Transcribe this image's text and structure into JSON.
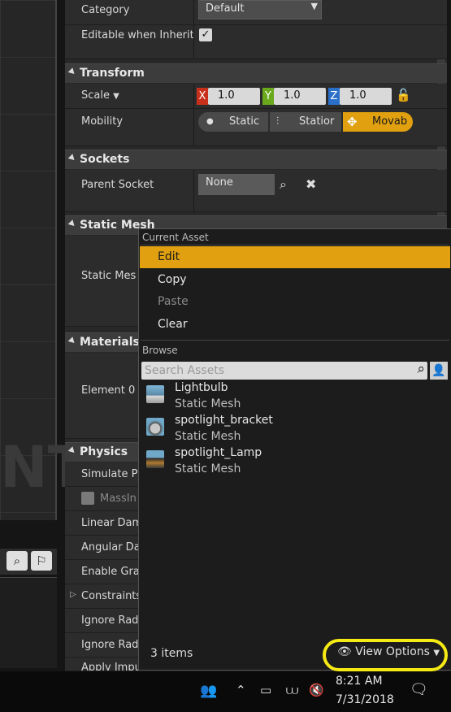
{
  "viewport": {
    "overlay_text": "NT"
  },
  "details": {
    "category_label": "Category",
    "category_value": "Default",
    "editable_label": "Editable when Inherit",
    "transform": {
      "title": "Transform",
      "scale_label": "Scale",
      "x_axis": "X",
      "x_value": "1.0",
      "y_axis": "Y",
      "y_value": "1.0",
      "z_axis": "Z",
      "z_value": "1.0",
      "mobility_label": "Mobility",
      "mobility_options": [
        "Static",
        "Statior",
        "Movab"
      ],
      "mobility_selected": "Movab"
    },
    "sockets": {
      "title": "Sockets",
      "parent_socket_label": "Parent Socket",
      "parent_socket_value": "None"
    },
    "static_mesh": {
      "title": "Static Mesh",
      "static_mesh_label": "Static Mes"
    },
    "materials": {
      "title": "Materials",
      "element0_label": "Element 0"
    },
    "physics": {
      "title": "Physics",
      "rows": [
        "Simulate P",
        "MassIn",
        "Linear Dam",
        "Angular Da",
        "Enable Gra",
        "Constraints",
        "Ignore Rad",
        "Ignore Rad",
        "Apply Impu"
      ]
    }
  },
  "menu": {
    "current_asset_header": "Current Asset",
    "items": [
      "Edit",
      "Copy",
      "Paste",
      "Clear"
    ],
    "browse_header": "Browse",
    "search_placeholder": "Search Assets",
    "assets": [
      {
        "name": "Lightbulb",
        "type": "Static Mesh"
      },
      {
        "name": "spotlight_bracket",
        "type": "Static Mesh"
      },
      {
        "name": "spotlight_Lamp",
        "type": "Static Mesh"
      }
    ],
    "item_count": "3 items",
    "view_options": "View Options"
  },
  "taskbar": {
    "time": "8:21 AM",
    "date": "7/31/2018"
  },
  "colors": {
    "accent": "#e0a010",
    "highlight_ring": "#f5ea14",
    "x_axis": "#c8301c",
    "y_axis": "#6aa81c",
    "z_axis": "#2a6fc8"
  }
}
